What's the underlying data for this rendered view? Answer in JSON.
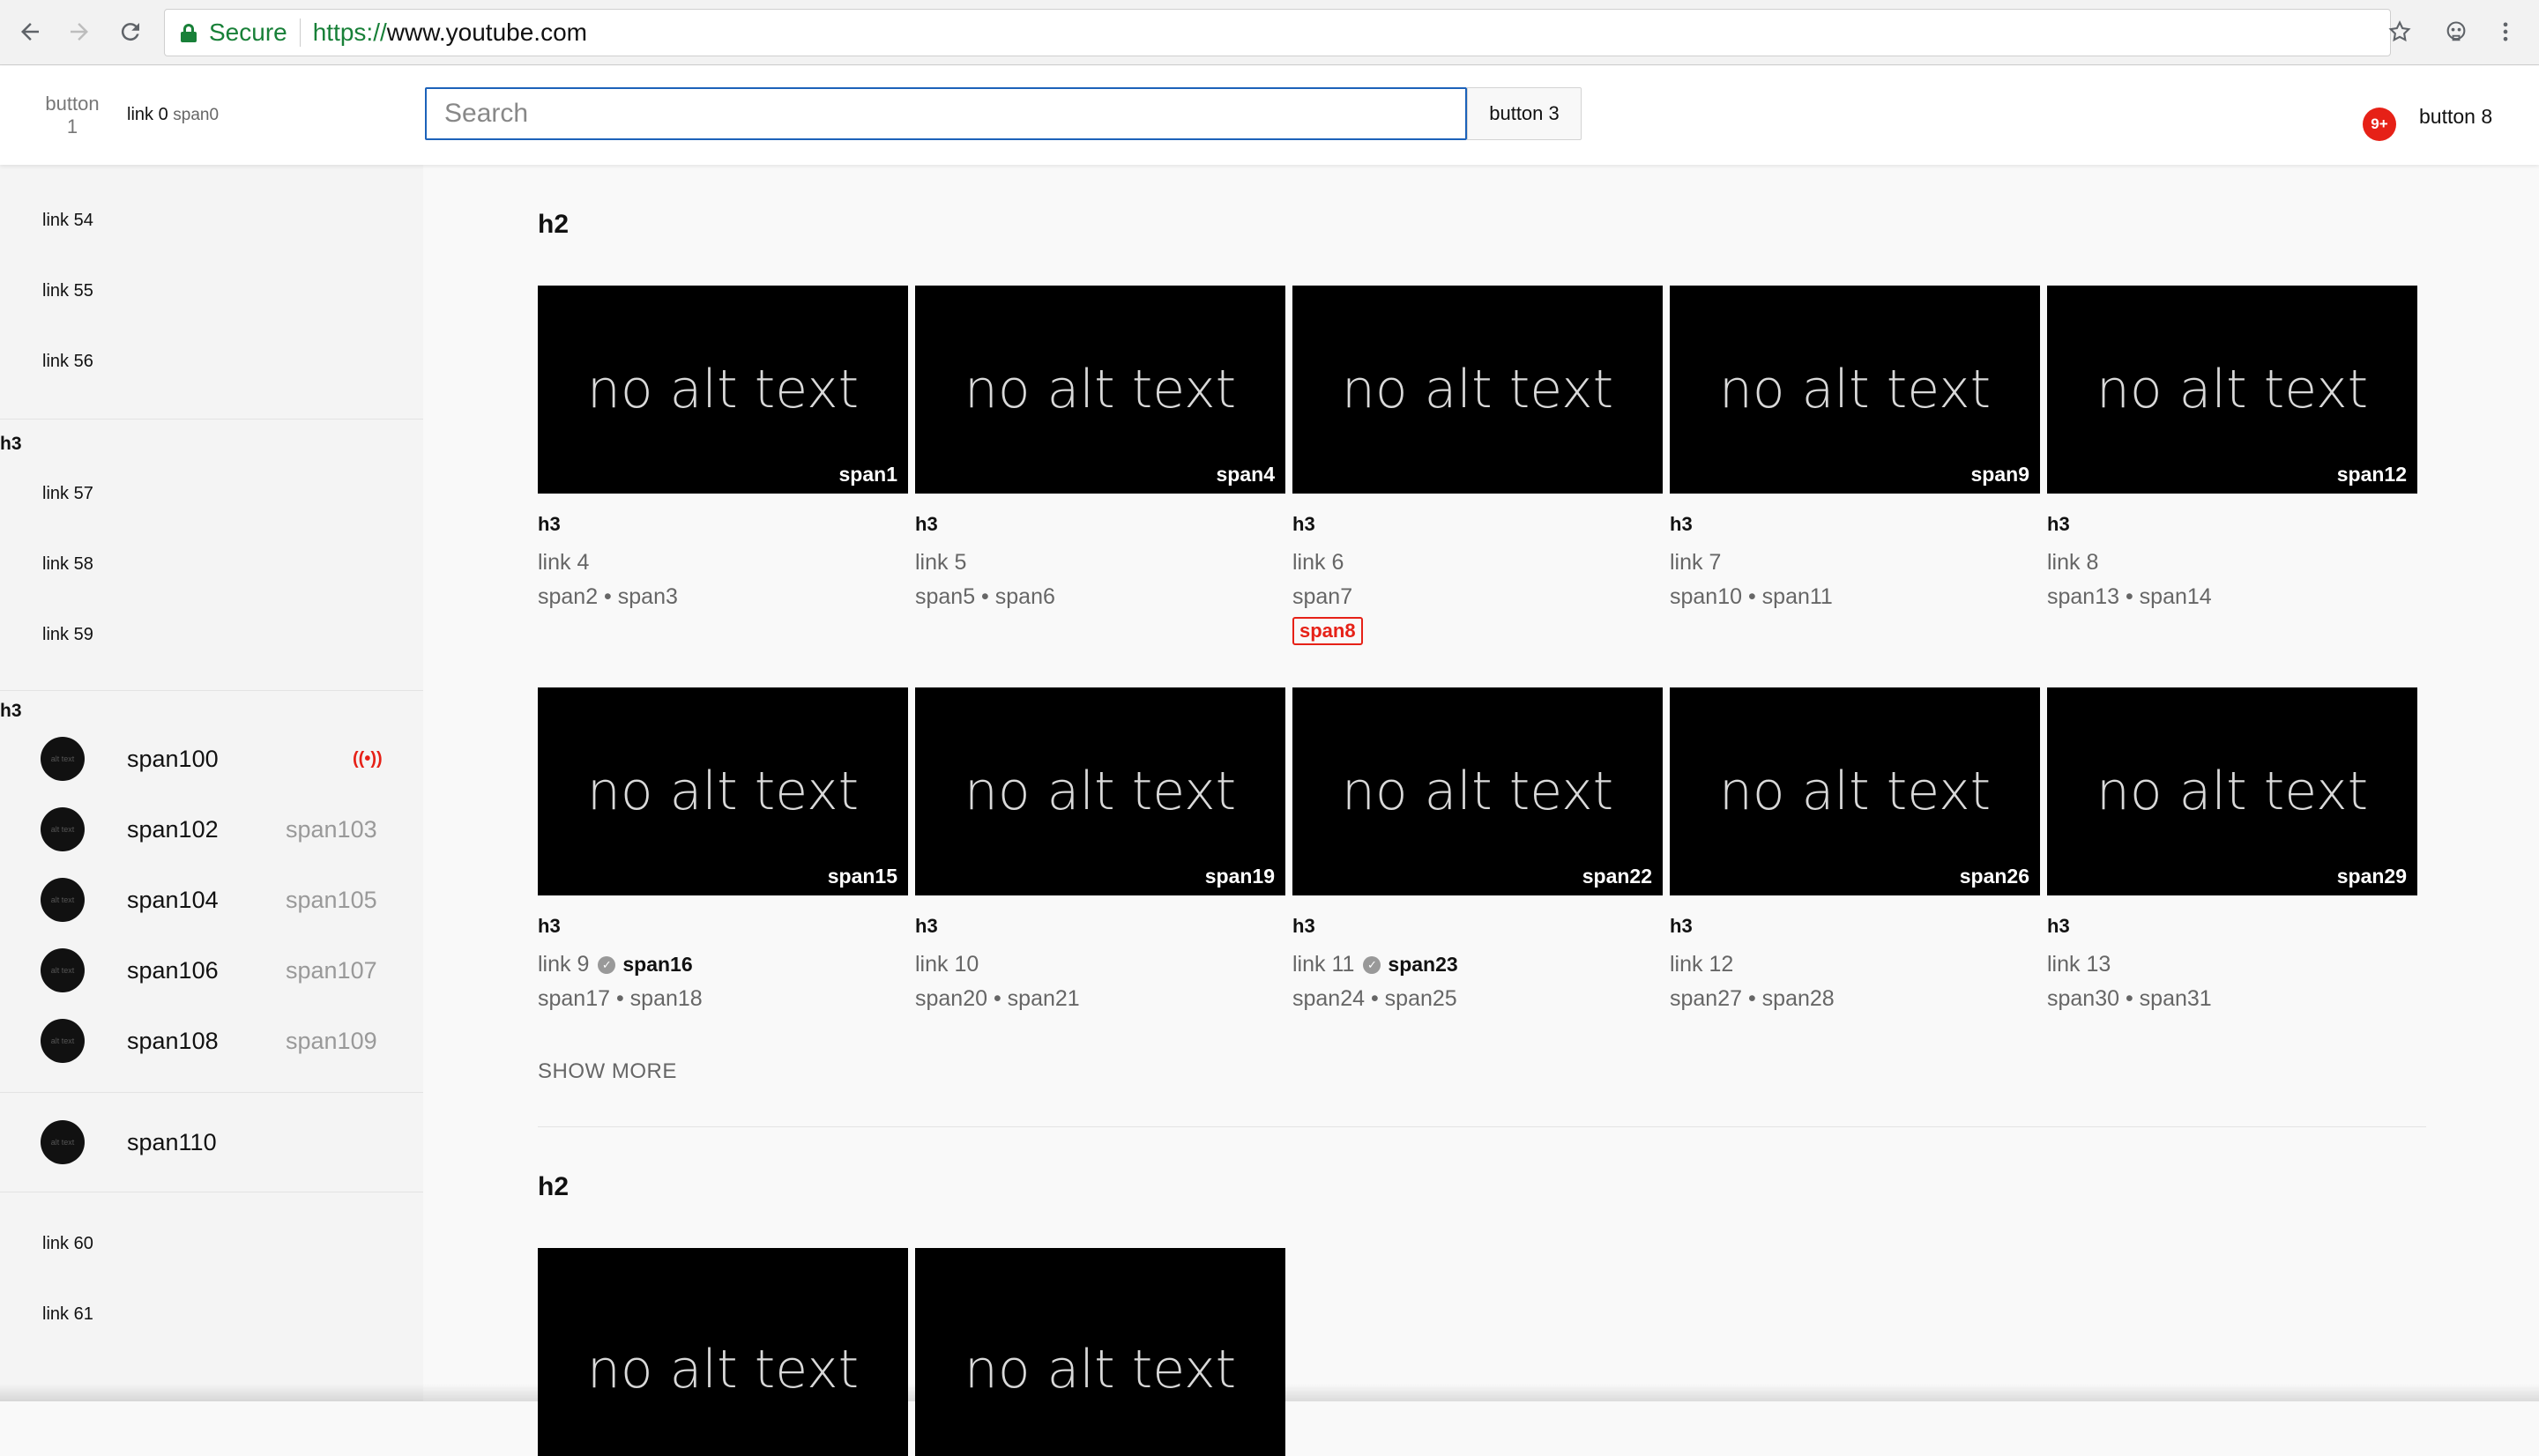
{
  "browser": {
    "secure_label": "Secure",
    "url_scheme": "https://",
    "url_host": "www.youtube.com",
    "icons": [
      "back-arrow-icon",
      "forward-arrow-icon",
      "reload-icon",
      "lock-icon",
      "star-icon",
      "extension-icon",
      "menu-dots-icon"
    ]
  },
  "header": {
    "button1": "button 1",
    "logo_link": "link 0",
    "logo_span": "span0",
    "search_placeholder": "Search",
    "search_button": "button 3",
    "notification_count": "9+",
    "button8": "button 8"
  },
  "sidebar": {
    "links_top": [
      "link 54",
      "link 55",
      "link 56"
    ],
    "heading1": "h3",
    "links_mid": [
      "link 57",
      "link 58",
      "link 59"
    ],
    "heading2": "h3",
    "subscriptions": [
      {
        "name": "span100",
        "extra": "",
        "live": true,
        "avatar_alt": "alt text"
      },
      {
        "name": "span102",
        "extra": "span103",
        "live": false,
        "avatar_alt": "alt text"
      },
      {
        "name": "span104",
        "extra": "span105",
        "live": false,
        "avatar_alt": "alt text"
      },
      {
        "name": "span106",
        "extra": "span107",
        "live": false,
        "avatar_alt": "alt text"
      },
      {
        "name": "span108",
        "extra": "span109",
        "live": false,
        "avatar_alt": "alt text"
      }
    ],
    "extra_sub": {
      "name": "span110",
      "avatar_alt": "alt text"
    },
    "live_icon_glyph": "((•))",
    "links_bottom": [
      "link 60",
      "link 61"
    ]
  },
  "main": {
    "section1_title": "h2",
    "section2_title": "h2",
    "thumb_alt": "no alt text",
    "show_more": "SHOW MORE",
    "verified_glyph": "✓",
    "row1": [
      {
        "duration": "span1",
        "h3": "h3",
        "link": "link 4",
        "meta": "span2 • span3"
      },
      {
        "duration": "span4",
        "h3": "h3",
        "link": "link 5",
        "meta": "span5 • span6"
      },
      {
        "duration": "",
        "h3": "h3",
        "link": "link 6",
        "meta": "span7",
        "badge": "span8"
      },
      {
        "duration": "span9",
        "h3": "h3",
        "link": "link 7",
        "meta": "span10 • span11"
      },
      {
        "duration": "span12",
        "h3": "h3",
        "link": "link 8",
        "meta": "span13 • span14"
      }
    ],
    "row2": [
      {
        "duration": "span15",
        "h3": "h3",
        "link": "link 9",
        "channel": "span16",
        "verified": true,
        "meta": "span17 • span18"
      },
      {
        "duration": "span19",
        "h3": "h3",
        "link": "link 10",
        "meta": "span20 • span21"
      },
      {
        "duration": "span22",
        "h3": "h3",
        "link": "link 11",
        "channel": "span23",
        "verified": true,
        "meta": "span24 • span25"
      },
      {
        "duration": "span26",
        "h3": "h3",
        "link": "link 12",
        "meta": "span27 • span28"
      },
      {
        "duration": "span29",
        "h3": "h3",
        "link": "link 13",
        "meta": "span30 • span31"
      }
    ]
  },
  "colors": {
    "accent_red": "#e62117",
    "secure_green": "#188038",
    "search_border": "#1c62b9"
  }
}
